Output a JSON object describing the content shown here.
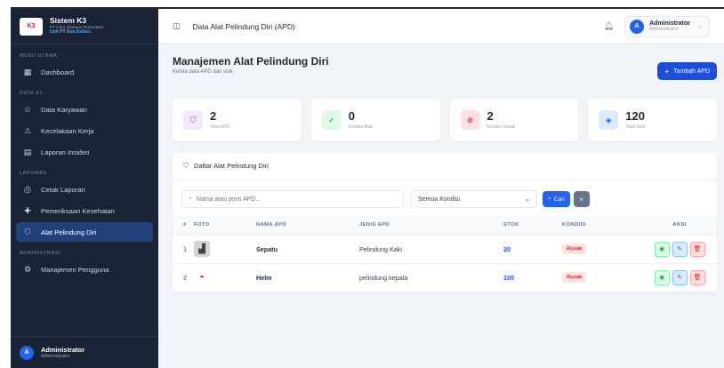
{
  "brand": {
    "logo": "K3",
    "title": "Sistem K3",
    "company": "PT Citra Wahana Nusantara",
    "unit": "Unit PT Dua Kelinci"
  },
  "sidebar": {
    "sections": [
      {
        "title": "MENU UTAMA",
        "items": [
          {
            "label": "Dashboard",
            "icon": "dashboard-icon",
            "glyph": "▦"
          }
        ]
      },
      {
        "title": "DATA K3",
        "items": [
          {
            "label": "Data Karyawan",
            "icon": "users-icon",
            "glyph": "☺"
          },
          {
            "label": "Kecelakaan Kerja",
            "icon": "warning-icon",
            "glyph": "⚠"
          },
          {
            "label": "Laporan Insiden",
            "icon": "document-icon",
            "glyph": "▤"
          }
        ]
      },
      {
        "title": "LAPORAN",
        "items": [
          {
            "label": "Cetak Laporan",
            "icon": "printer-icon",
            "glyph": "⎙"
          },
          {
            "label": "Pemeriksaan Kesehatan",
            "icon": "health-icon",
            "glyph": "✚"
          },
          {
            "label": "Alat Pelindung Diri",
            "icon": "shield-icon",
            "glyph": "⛉",
            "active": true
          }
        ]
      },
      {
        "title": "ADMINISTRASI",
        "items": [
          {
            "label": "Manajemen Pengguna",
            "icon": "user-cog-icon",
            "glyph": "⚙"
          }
        ]
      }
    ],
    "user": {
      "initial": "A",
      "name": "Administrator",
      "role": "Administrator"
    }
  },
  "topbar": {
    "title": "Data Alat Pelindung Diri (APD)",
    "user_initial": "A",
    "user_name": "Administrator",
    "user_role": "Administrator"
  },
  "header": {
    "title": "Manajemen Alat Pelindung Diri",
    "subtitle": "Kelola data APD dan stok",
    "add_label": "Tambah APD"
  },
  "stats": [
    {
      "value": "2",
      "label": "Total APD",
      "icon": "shield-icon",
      "glyph": "⛉",
      "bg": "#f3e8ff",
      "fg": "#9333ea"
    },
    {
      "value": "0",
      "label": "Kondisi Baik",
      "icon": "check-circle-icon",
      "glyph": "✓",
      "bg": "#dcfce7",
      "fg": "#16a34a"
    },
    {
      "value": "2",
      "label": "Kondisi Rusak",
      "icon": "x-circle-icon",
      "glyph": "⊗",
      "bg": "#fee2e2",
      "fg": "#dc2626"
    },
    {
      "value": "120",
      "label": "Total Stok",
      "icon": "box-icon",
      "glyph": "◈",
      "bg": "#dbeafe",
      "fg": "#2563eb"
    }
  ],
  "list": {
    "title": "Daftar Alat Pelindung Diri",
    "search_placeholder": "Nama atau jenis APD...",
    "filter_value": "Semua Kondisi",
    "search_button": "Cari",
    "columns": {
      "no": "#",
      "foto": "FOTO",
      "nama": "NAMA APD",
      "jenis": "JENIS APD",
      "stok": "STOK",
      "kondisi": "KONDISI",
      "aksi": "AKSI"
    },
    "rows": [
      {
        "no": "1",
        "nama": "Sepatu",
        "jenis": "Pelindung Kaki",
        "stok": "20",
        "kondisi": "Rusak",
        "photo_icon": "boots-photo-icon",
        "photo_glyph": "▟",
        "photo_bg": "#d6d3d1",
        "photo_fg": "#44403c"
      },
      {
        "no": "2",
        "nama": "Helm",
        "jenis": "pelindung kepala",
        "stok": "100",
        "kondisi": "Rusak",
        "photo_icon": "helmet-photo-icon",
        "photo_glyph": "◓",
        "photo_bg": "#ffffff",
        "photo_fg": "#dc2626"
      }
    ]
  }
}
